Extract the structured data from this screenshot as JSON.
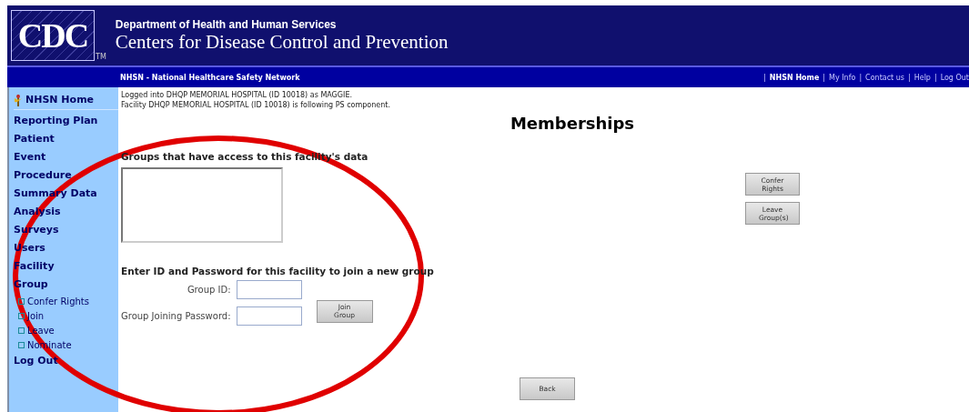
{
  "header": {
    "logo": "CDC",
    "logo_mark": "TM",
    "department": "Department of Health and Human Services",
    "agency": "Centers for Disease Control and Prevention"
  },
  "navbar": {
    "title": "NHSN - National Healthcare Safety Network",
    "separator": "|",
    "links": [
      {
        "label": "NHSN Home",
        "selected": true
      },
      {
        "label": "My Info",
        "selected": false
      },
      {
        "label": "Contact us",
        "selected": false
      },
      {
        "label": "Help",
        "selected": false
      },
      {
        "label": "Log Out",
        "selected": false
      }
    ]
  },
  "sidebar": {
    "home": "NHSN Home",
    "items": [
      {
        "label": "Reporting Plan"
      },
      {
        "label": "Patient"
      },
      {
        "label": "Event"
      },
      {
        "label": "Procedure"
      },
      {
        "label": "Summary Data"
      },
      {
        "label": "Analysis"
      },
      {
        "label": "Surveys"
      },
      {
        "label": "Users"
      },
      {
        "label": "Facility"
      },
      {
        "label": "Group",
        "children": [
          {
            "label": "Confer Rights"
          },
          {
            "label": "Join"
          },
          {
            "label": "Leave"
          },
          {
            "label": "Nominate"
          }
        ]
      },
      {
        "label": "Log Out"
      }
    ]
  },
  "status_lines": [
    "Logged into DHQP MEMORIAL HOSPITAL (ID 10018) as MAGGIE.",
    "Facility DHQP MEMORIAL HOSPITAL (ID 10018) is following PS component."
  ],
  "page_title": "Memberships",
  "groups": {
    "heading": "Groups that have access to this facility's data",
    "buttons": [
      "Confer Rights",
      "Leave Group(s)"
    ]
  },
  "join": {
    "heading": "Enter ID and Password for this facility to join a new group",
    "fields": [
      {
        "label": "Group ID:"
      },
      {
        "label": "Group Joining Password:"
      }
    ],
    "button": "Join Group"
  },
  "back_button": "Back"
}
